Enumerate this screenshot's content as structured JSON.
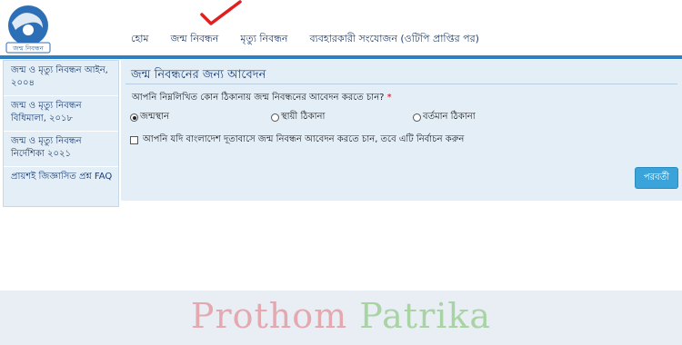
{
  "logo": {
    "caption": "জন্ম নিবন্ধন"
  },
  "nav": {
    "items": [
      {
        "label": "হোম"
      },
      {
        "label": "জন্ম নিবন্ধন"
      },
      {
        "label": "মৃত্যু নিবন্ধন"
      },
      {
        "label": "ব্যবহারকারী সংযোজন (ওটিপি প্রাপ্তির পর)"
      }
    ]
  },
  "sidebar": {
    "items": [
      {
        "label": "জন্ম ও মৃত্যু নিবন্ধন আইন, ২০০৪"
      },
      {
        "label": "জন্ম ও মৃত্যু নিবন্ধন বিধিমালা, ২০১৮"
      },
      {
        "label": "জন্ম ও মৃত্যু নিবন্ধন নির্দেশিকা ২০২১"
      },
      {
        "label": "প্রায়শই জিজ্ঞাসিত প্রশ্ন FAQ"
      }
    ]
  },
  "form": {
    "title": "জন্ম নিবন্ধনের জন্য আবেদন",
    "question": "আপনি নিম্নলিখিত কোন ঠিকানায় জন্ম নিবন্ধনের আবেদন করতে চান?",
    "required_mark": "*",
    "options": [
      {
        "label": "জন্মস্থান",
        "selected": true
      },
      {
        "label": "স্থায়ী ঠিকানা",
        "selected": false
      },
      {
        "label": "বর্তমান ঠিকানা",
        "selected": false
      }
    ],
    "embassy_checkbox_label": "আপনি যদি বাংলাদেশ দূতাবাসে জন্ম নিবন্ধন আবেদন করতে চান, তবে এটি নির্বাচন করুন",
    "next_button": "পরবর্তী"
  },
  "watermark": {
    "word1": "Prothom",
    "word2": "Patrika"
  },
  "colors": {
    "accent": "#2d7fc3",
    "panel": "#e3eef7",
    "button": "#3aa3d9",
    "check_mark": "#e02020"
  }
}
